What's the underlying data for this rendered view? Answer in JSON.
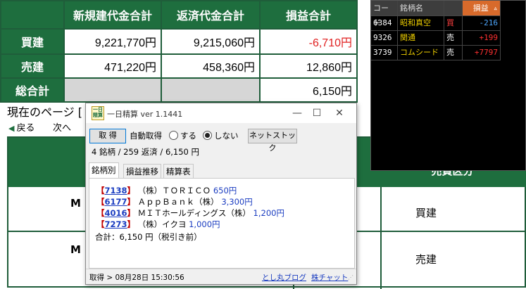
{
  "summary": {
    "headers": [
      "新規建代金合計",
      "返済代金合計",
      "損益合計"
    ],
    "rows": [
      {
        "label": "買建",
        "new": "9,221,770円",
        "close": "9,215,060円",
        "pl": "-6,710円"
      },
      {
        "label": "売建",
        "new": "471,220円",
        "close": "458,360円",
        "pl": "12,860円"
      },
      {
        "label": "総合計",
        "new": "",
        "close": "",
        "pl": "6,150円"
      }
    ],
    "negative_color": "#e02020",
    "header_bg": "#1e6e3e"
  },
  "background": {
    "page_label": "現在のページ [",
    "back": "戻る",
    "next": "次へ",
    "buying_power_partial": "売買区分",
    "rows": [
      {
        "name_partial": "M I",
        "side": "買建"
      },
      {
        "name_partial": "M I",
        "side": "売建"
      }
    ]
  },
  "ticker": {
    "headers": {
      "code": "コード",
      "name": "銘柄名",
      "pl": "損益 ▵"
    },
    "rows": [
      {
        "code": "6384",
        "name": "昭和真空",
        "side": "買",
        "pl": "-216"
      },
      {
        "code": "9326",
        "name": "関通",
        "side": "売",
        "pl": "+199"
      },
      {
        "code": "3739",
        "name": "コムシード",
        "side": "売",
        "pl": "+7797"
      }
    ]
  },
  "window": {
    "icon_text": "一日精算",
    "title": "一日精算 ver 1.1441",
    "controls": {
      "minimize": "—",
      "maximize": "☐",
      "close": "✕"
    },
    "fetch_button": "取 得",
    "auto_fetch_label": "自動取得",
    "radio_on": "する",
    "radio_off": "しない",
    "auto_fetch_selected": "しない",
    "net_stock_button": "ネットストック",
    "stats": "4 銘柄 / 259 返済 / 6,150 円",
    "tabs": [
      "銘柄別",
      "損益推移",
      "精算表"
    ],
    "active_tab": "銘柄別",
    "entries": [
      {
        "code": "7138",
        "name": "（株）ＴＯＲＩＣＯ",
        "amount": "650円"
      },
      {
        "code": "6177",
        "name": "ＡｐｐＢａｎｋ（株）",
        "amount": "3,300円"
      },
      {
        "code": "4016",
        "name": "ＭＩＴホールディングス（株）",
        "amount": "1,200円"
      },
      {
        "code": "7273",
        "name": "（株）イクヨ",
        "amount": "1,000円"
      }
    ],
    "total": "合計：6,150 円（税引き前）",
    "status": "取得 > 08月28日 15:30:56",
    "link_blog": "とし丸ブログ",
    "link_chat": "株チャット"
  }
}
